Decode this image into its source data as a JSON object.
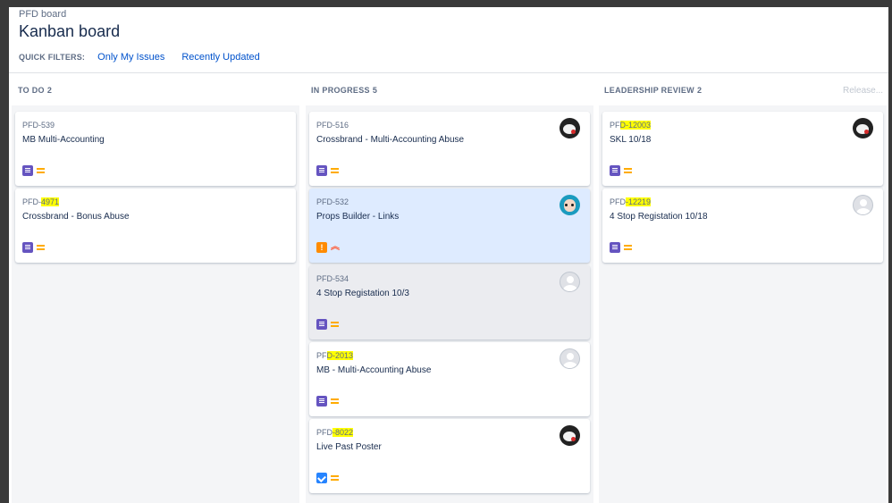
{
  "header": {
    "breadcrumb": "PFD board",
    "title": "Kanban board",
    "quick_filters_label": "QUICK FILTERS:",
    "quick_filters": [
      "Only My Issues",
      "Recently Updated"
    ],
    "release_label": "Release..."
  },
  "columns": [
    {
      "name": "TO DO",
      "count": "2",
      "cards": [
        {
          "key_prefix": "PFD-539",
          "key_highlight": "",
          "summary": "MB Multi-Accounting",
          "type": "story-icon",
          "priority": "medium-priority-icon",
          "avatar": ""
        },
        {
          "key_prefix": "PFD-",
          "key_highlight": "4971",
          "summary": "Crossbrand - Bonus Abuse",
          "type": "story-icon",
          "priority": "medium-priority-icon",
          "avatar": ""
        }
      ]
    },
    {
      "name": "IN PROGRESS",
      "count": "5",
      "cards": [
        {
          "key_prefix": "PFD-516",
          "key_highlight": "",
          "summary": "Crossbrand - Multi-Accounting Abuse",
          "type": "story-icon",
          "priority": "medium-priority-icon",
          "avatar": "dark-avatar"
        },
        {
          "key_prefix": "PFD-532",
          "key_highlight": "",
          "summary": "Props Builder - Links",
          "type": "bug-icon",
          "priority": "high-priority-icon",
          "avatar": "art-avatar"
        },
        {
          "key_prefix": "PFD-534",
          "key_highlight": "",
          "summary": "4 Stop Registation 10/3",
          "type": "story-icon",
          "priority": "medium-priority-icon",
          "avatar": "default-avatar"
        },
        {
          "key_prefix": "PF",
          "key_highlight": "D-2013",
          "summary": "MB - Multi-Accounting Abuse",
          "type": "story-icon",
          "priority": "medium-priority-icon",
          "avatar": "default-avatar"
        },
        {
          "key_prefix": "PFD",
          "key_highlight": "-8022",
          "summary": "Live Past Poster",
          "type": "task-icon",
          "priority": "medium-priority-icon",
          "avatar": "dark-avatar"
        }
      ]
    },
    {
      "name": "LEADERSHIP REVIEW",
      "count": "2",
      "cards": [
        {
          "key_prefix": "PF",
          "key_highlight": "D-12003",
          "summary": "SKL 10/18",
          "type": "story-icon",
          "priority": "medium-priority-icon",
          "avatar": "dark-avatar"
        },
        {
          "key_prefix": "PFD",
          "key_highlight": "-12219",
          "summary": "4 Stop Registation 10/18",
          "type": "story-icon",
          "priority": "medium-priority-icon",
          "avatar": "default-avatar"
        }
      ]
    }
  ],
  "colors": {
    "link": "#0052cc",
    "highlight": "#ffff00",
    "story": "#6554c0",
    "task": "#2684ff",
    "bug": "#ff8b00",
    "selected_card": "#deebff"
  }
}
